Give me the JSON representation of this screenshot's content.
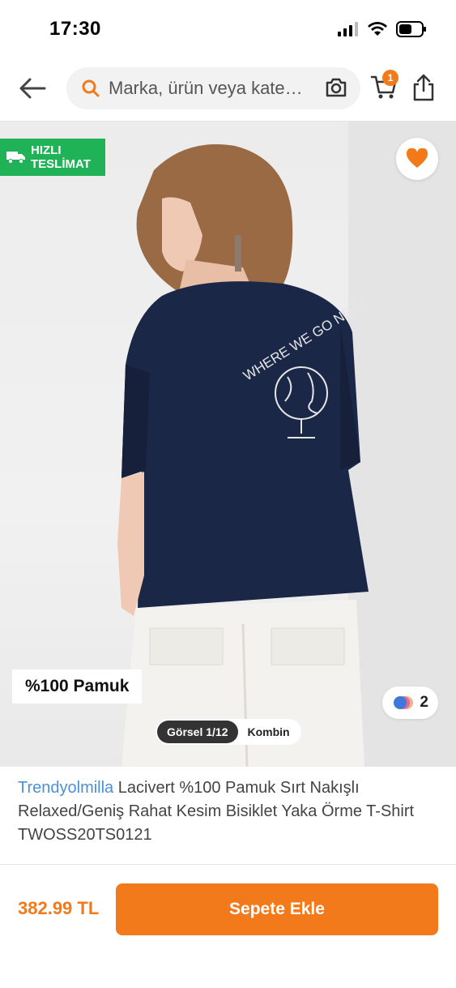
{
  "status_bar": {
    "time": "17:30",
    "icons": [
      "signal-icon",
      "wifi-icon",
      "battery-icon"
    ]
  },
  "header": {
    "search_placeholder": "Marka, ürün veya kate…",
    "cart_count": "1",
    "icons": [
      "back-arrow-icon",
      "search-icon",
      "camera-icon",
      "cart-icon",
      "share-icon"
    ]
  },
  "product_image": {
    "fast_delivery_line1": "HIZLI",
    "fast_delivery_line2": "TESLİMAT",
    "material_badge": "%100 Pamuk",
    "color_count": "2",
    "tabs": [
      {
        "label": "Görsel 1/12",
        "active": true
      },
      {
        "label": "Kombin",
        "active": false
      }
    ],
    "print_text": "WHERE WE GO NEXT"
  },
  "product": {
    "brand": "Trendyolmilla",
    "title": "Lacivert %100 Pamuk Sırt Nakışlı Relaxed/Geniş Rahat Kesim Bisiklet Yaka Örme T-Shirt TWOSS20TS0121"
  },
  "bottom_bar": {
    "price": "382.99 TL",
    "add_to_cart": "Sepete Ekle"
  },
  "colors": {
    "accent": "#f27a1a",
    "fast_delivery": "#1fb256",
    "brand_link": "#4a90d9",
    "shirt": "#1b2747"
  }
}
